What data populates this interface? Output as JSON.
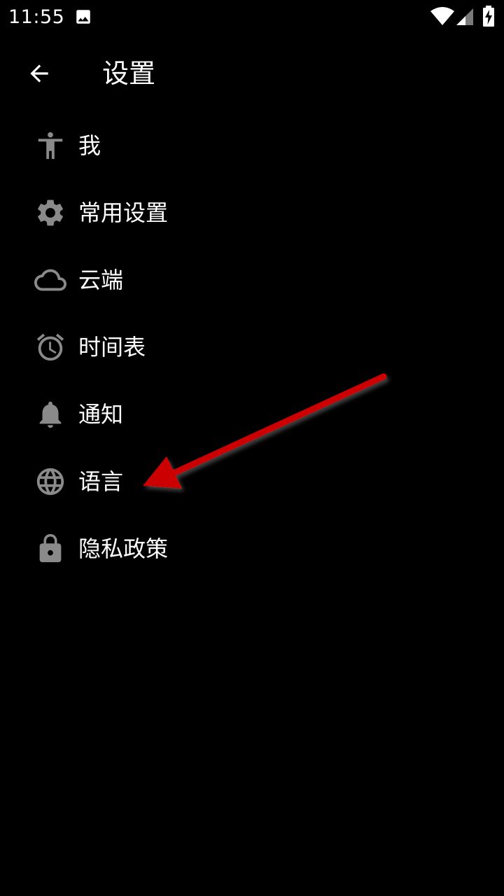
{
  "status_bar": {
    "time": "11:55",
    "icons": [
      "image-notification-icon",
      "wifi-icon",
      "cellular-signal-icon",
      "battery-charging-icon"
    ]
  },
  "app_bar": {
    "back_icon": "arrow-left-icon",
    "title": "设置"
  },
  "menu": {
    "items": [
      {
        "label": "我",
        "icon": "person-icon"
      },
      {
        "label": "常用设置",
        "icon": "gear-icon"
      },
      {
        "label": "云端",
        "icon": "cloud-icon"
      },
      {
        "label": "时间表",
        "icon": "alarm-clock-icon"
      },
      {
        "label": "通知",
        "icon": "bell-icon"
      },
      {
        "label": "语言",
        "icon": "globe-icon"
      },
      {
        "label": "隐私政策",
        "icon": "lock-icon"
      }
    ]
  },
  "colors": {
    "background": "#000000",
    "text": "#ffffff",
    "icon": "#8a8a8a",
    "annotation_arrow": "#cc0000"
  }
}
